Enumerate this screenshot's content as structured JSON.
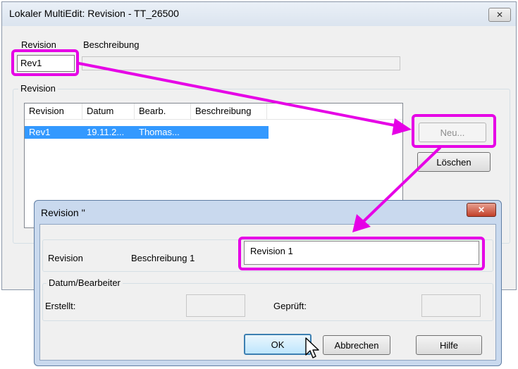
{
  "main_window": {
    "title": "Lokaler MultiEdit: Revision - TT_26500",
    "close_glyph": "✕",
    "label_revision": "Revision",
    "label_beschreibung": "Beschreibung",
    "revision_value": "Rev1",
    "group_revision": "Revision",
    "list_headers": [
      "Revision",
      "Datum",
      "Bearb.",
      "Beschreibung"
    ],
    "list_rows": [
      {
        "revision": "Rev1",
        "datum": "19.11.2...",
        "bearb": "Thomas...",
        "beschreibung": ""
      }
    ],
    "btn_neu": "Neu...",
    "btn_loeschen": "Löschen"
  },
  "dialog": {
    "title": "Revision ''",
    "close_glyph": "✕",
    "label_revision": "Revision",
    "label_beschreibung": "Beschreibung 1",
    "beschreibung_value": "Revision 1",
    "group_datum": "Datum/Bearbeiter",
    "label_erstellt": "Erstellt:",
    "label_geprueft": "Geprüft:",
    "btn_ok": "OK",
    "btn_abbrechen": "Abbrechen",
    "btn_hilfe": "Hilfe"
  },
  "annotation_color": "#e600e6",
  "selection_color": "#3399ff"
}
